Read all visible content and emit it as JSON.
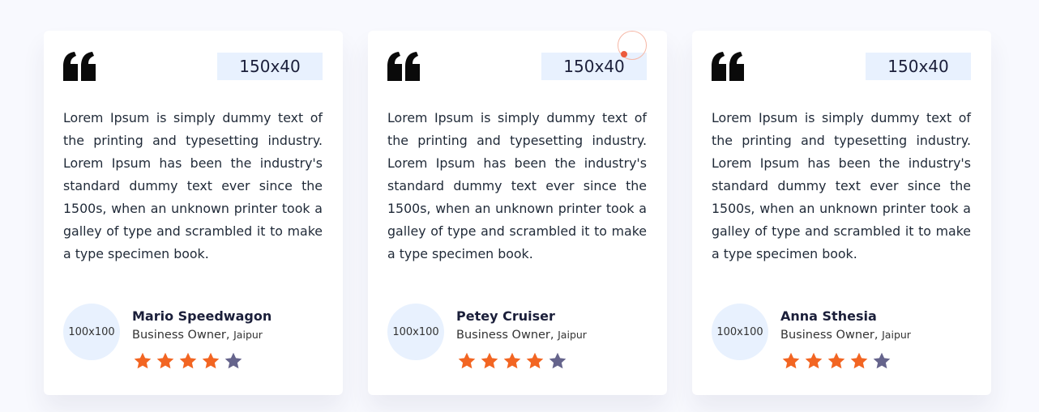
{
  "colors": {
    "star_filled": "#f26522",
    "star_empty": "#65648c",
    "placeholder_bg": "#e8f1fe",
    "cursor": "#ec5a3c"
  },
  "testimonials": [
    {
      "logo": "150x40",
      "text": "Lorem Ipsum is simply dummy text of the printing and typesetting industry. Lorem Ipsum has been the industry's standard dummy text ever since the 1500s, when an unknown printer took a galley of type and scrambled it to make a type specimen book.",
      "avatar": "100x100",
      "name": "Mario Speedwagon",
      "role": "Business Owner,",
      "city": "Jaipur",
      "rating": 4,
      "max_rating": 5
    },
    {
      "logo": "150x40",
      "text": "Lorem Ipsum is simply dummy text of the printing and typesetting industry. Lorem Ipsum has been the industry's standard dummy text ever since the 1500s, when an unknown printer took a galley of type and scrambled it to make a type specimen book.",
      "avatar": "100x100",
      "name": "Petey Cruiser",
      "role": "Business Owner,",
      "city": "Jaipur",
      "rating": 4,
      "max_rating": 5
    },
    {
      "logo": "150x40",
      "text": "Lorem Ipsum is simply dummy text of the printing and typesetting industry. Lorem Ipsum has been the industry's standard dummy text ever since the 1500s, when an unknown printer took a galley of type and scrambled it to make a type specimen book.",
      "avatar": "100x100",
      "name": "Anna Sthesia",
      "role": "Business Owner,",
      "city": "Jaipur",
      "rating": 4,
      "max_rating": 5
    }
  ]
}
